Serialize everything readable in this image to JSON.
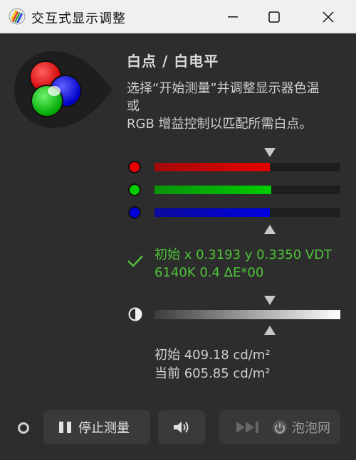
{
  "window": {
    "title": "交互式显示调整",
    "minimize_icon": "minimize-icon",
    "maximize_icon": "maximize-icon",
    "close_icon": "close-icon"
  },
  "main": {
    "heading": "白点 / 白电平",
    "instruction_lines": [
      "选择“开始测量”并调整显示器色温",
      "或",
      "RGB 增益控制以匹配所需白点。"
    ]
  },
  "rgb_bars": [
    {
      "channel": "red",
      "color": "#e60000",
      "level": 0.62
    },
    {
      "channel": "green",
      "color": "#00cc00",
      "level": 0.63
    },
    {
      "channel": "blue",
      "color": "#0000dd",
      "level": 0.62
    }
  ],
  "status": {
    "icon": "checkmark-icon",
    "lines": [
      "初始 x 0.3193 y 0.3350 VDT",
      "6140K 0.4 ΔE*00"
    ],
    "color": "#4ec33a"
  },
  "luminance": {
    "icon": "contrast-icon",
    "lines": [
      "初始 409.18 cd/m²",
      "当前 605.85 cd/m²"
    ]
  },
  "footer": {
    "stop_button": "停止测量",
    "stop_icon": "pause-icon",
    "sound_icon": "speaker-icon",
    "next_icon": "skip-next-icon",
    "watermark": "泡泡网"
  }
}
